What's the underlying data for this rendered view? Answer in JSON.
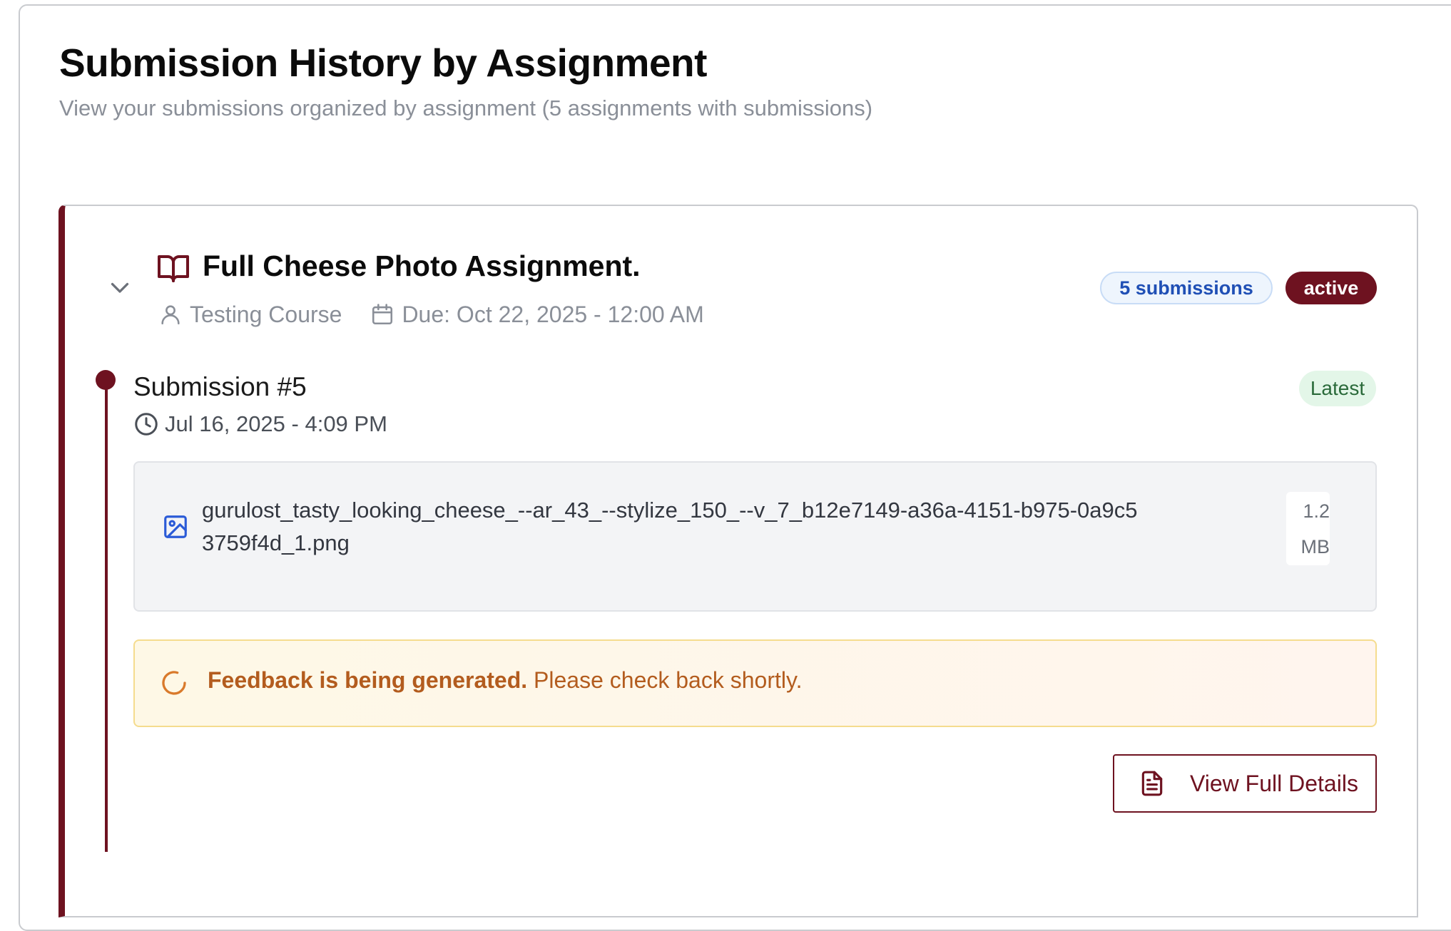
{
  "header": {
    "title": "Submission History by Assignment",
    "subtitle": "View your submissions organized by assignment (5 assignments with submissions)"
  },
  "assignment": {
    "title": "Full Cheese Photo Assignment.",
    "course": "Testing Course",
    "due": "Due: Oct 22, 2025 - 12:00 AM",
    "submissions_badge": "5 submissions",
    "status_badge": "active",
    "icons": {
      "toggle": "chevron-down-icon",
      "assignment": "book-open-icon",
      "course": "user-icon",
      "due": "calendar-icon"
    }
  },
  "submission": {
    "title": "Submission #5",
    "timestamp": "Jul 16, 2025 - 4:09 PM",
    "latest_badge": "Latest",
    "file": {
      "name": "gurulost_tasty_looking_cheese_--ar_43_--stylize_150_--v_7_b12e7149-a36a-4151-b975-0a9c53759f4d_1.png",
      "size": "1.2 MB",
      "icon": "image-icon"
    },
    "feedback": {
      "bold": "Feedback is being generated.",
      "message": "Please check back shortly.",
      "icon": "spinner-icon"
    },
    "details_button": {
      "label": "View Full Details",
      "icon": "file-text-icon"
    }
  },
  "colors": {
    "accent": "#6e1220",
    "badge_blue_text": "#1f4fb5",
    "latest_green_text": "#2a6a3a",
    "feedback_text": "#b35c1e"
  }
}
